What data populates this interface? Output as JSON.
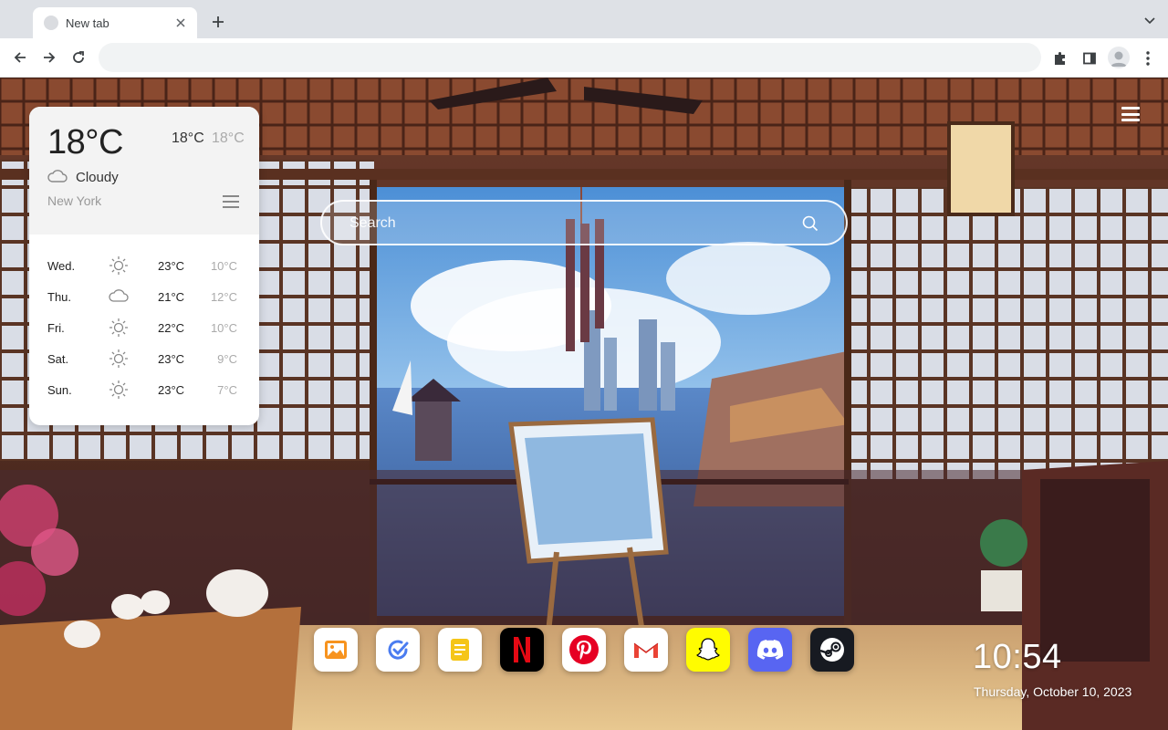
{
  "browser": {
    "tab": {
      "title": "New tab"
    },
    "omnibox": {
      "value": ""
    }
  },
  "weather": {
    "current_temp": "18°C",
    "high": "18°C",
    "low": "18°C",
    "condition": "Cloudy",
    "condition_icon": "cloud-icon",
    "city": "New York",
    "forecast": [
      {
        "day": "Wed.",
        "icon": "sun-icon",
        "high": "23°C",
        "low": "10°C"
      },
      {
        "day": "Thu.",
        "icon": "cloud-icon",
        "high": "21°C",
        "low": "12°C"
      },
      {
        "day": "Fri.",
        "icon": "sun-icon",
        "high": "22°C",
        "low": "10°C"
      },
      {
        "day": "Sat.",
        "icon": "sun-icon",
        "high": "23°C",
        "low": "9°C"
      },
      {
        "day": "Sun.",
        "icon": "sun-icon",
        "high": "23°C",
        "low": "7°C"
      }
    ]
  },
  "search": {
    "placeholder": "Search"
  },
  "dock": [
    {
      "name": "photos",
      "icon": "photos-icon"
    },
    {
      "name": "tasks",
      "icon": "tasks-icon"
    },
    {
      "name": "notes",
      "icon": "notes-icon"
    },
    {
      "name": "netflix",
      "icon": "netflix-icon"
    },
    {
      "name": "pinterest",
      "icon": "pinterest-icon"
    },
    {
      "name": "gmail",
      "icon": "gmail-icon"
    },
    {
      "name": "snapchat",
      "icon": "snapchat-icon"
    },
    {
      "name": "discord",
      "icon": "discord-icon"
    },
    {
      "name": "steam",
      "icon": "steam-icon"
    }
  ],
  "clock": {
    "time": "10:54",
    "date": "Thursday, October 10, 2023"
  },
  "colors": {
    "netflix": "#000000",
    "netflix_red": "#e50914",
    "pinterest": "#e60023",
    "gmail_red": "#ea4335",
    "snapchat": "#fffc00",
    "discord": "#5865f2",
    "steam": "#171a21"
  }
}
